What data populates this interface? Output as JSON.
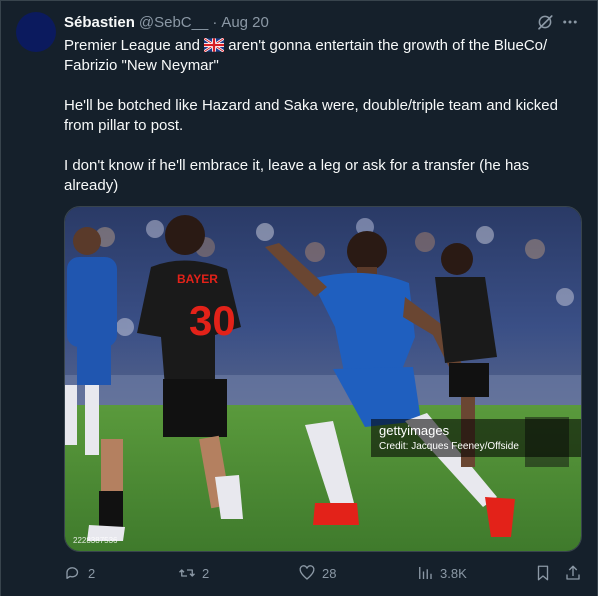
{
  "tweet": {
    "author_name": "Sébastien",
    "handle": "@SebC__",
    "separator": "·",
    "date": "Aug 20",
    "text_line1_a": "Premier League and",
    "text_line1_b": "aren't gonna entertain the growth of the BlueCo/",
    "text_line2": "Fabrizio \"New Neymar\"",
    "paragraph2": "He'll be botched like Hazard and Saka were, double/triple team and kicked from pillar to post.",
    "paragraph3": "I don't know if he'll embrace it, leave a leg or ask for a transfer (he has already)",
    "flag_icon": "uk-flag-icon"
  },
  "media": {
    "watermark_brand": "gettyimages",
    "credit": "Credit: Jacques Feeney/Offside",
    "image_id": "2228387536",
    "shirt_text": "BAYER",
    "shirt_number": "30",
    "colors": {
      "chelsea_blue": "#1f5fbf",
      "leverkusen_black": "#1a1a1a",
      "leverkusen_red": "#e32219",
      "pitch": "#4f8a36"
    }
  },
  "actions": {
    "replies": "2",
    "reposts": "2",
    "likes": "28",
    "views": "3.8K"
  },
  "theme": {
    "background": "#15202b",
    "border": "#38444d",
    "muted": "#8b98a5",
    "text": "#f7f9f9"
  }
}
